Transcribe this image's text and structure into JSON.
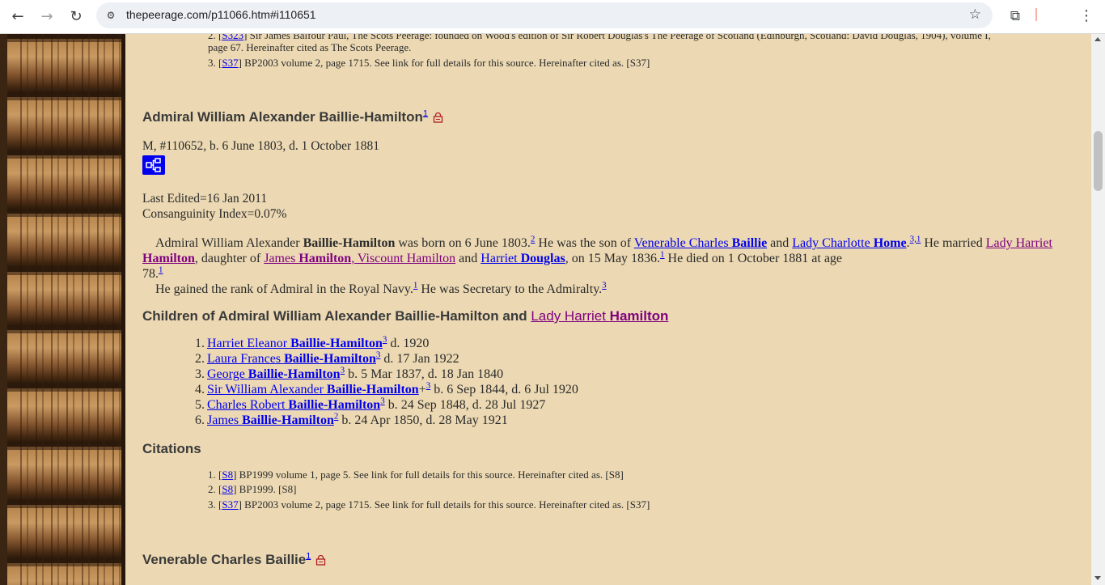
{
  "browser": {
    "url": "thepeerage.com/p11066.htm#i110651",
    "back_icon": "←",
    "forward_icon": "→",
    "reload_icon": "↻",
    "site_info_icon": "⚙",
    "star_icon": "☆",
    "extensions_icon": "⧉",
    "menu_icon": "⋮"
  },
  "top_citations": [
    {
      "num": "2.",
      "link": "S323",
      "text": " Sir James Balfour Paul, The Scots Peerage: founded on Wood's edition of Sir Robert Douglas's The Peerage of Scotland (Edinburgh, Scotland: David Douglas, 1904), volume I,"
    },
    {
      "num": "",
      "link": "",
      "text": "page 67. Hereinafter cited as The Scots Peerage."
    },
    {
      "num": "3.",
      "link": "S37",
      "text": " BP2003 volume 2, page 1715. See link for full details for this source. Hereinafter cited as. [S37]"
    }
  ],
  "person": {
    "name": "Admiral William Alexander Baillie-Hamilton",
    "name_sup": "1",
    "info": "M, #110652, b. 6 June 1803, d. 1 October 1881",
    "last_edited": "Last Edited=16 Jan 2011",
    "consanguinity": "Consanguinity Index=0.07%"
  },
  "bio": {
    "p1_a": "Admiral William Alexander ",
    "p1_b": "Baillie-Hamilton",
    "p1_c": " was born on 6 June 1803.",
    "sup1": "2",
    "p1_d": " He was the son of ",
    "father_first": "Venerable Charles ",
    "father_last": "Baillie",
    "p1_e": " and ",
    "mother_first": "Lady Charlotte ",
    "mother_last": "Home",
    "sup2": "3,1",
    "p1_f": " He married ",
    "wife_first": "Lady Harriet ",
    "wife_last": "Hamilton",
    "p1_g": ", daughter of ",
    "wf_first": "James ",
    "wf_last": "Hamilton",
    "wf_title": ", Viscount Hamilton",
    "p1_h": " and ",
    "wm_first": "Harriet ",
    "wm_last": "Douglas",
    "p1_i": ", on 15 May 1836.",
    "sup3": "1",
    "p1_j": " He died on 1 October 1881 at age",
    "p1_k": "78.",
    "sup4": "1",
    "p2_a": "He gained the rank of Admiral in the Royal Navy.",
    "sup5": "1",
    "p2_b": " He was Secretary to the Admiralty.",
    "sup6": "3"
  },
  "children_header": {
    "prefix": "Children of Admiral William Alexander Baillie-Hamilton and ",
    "spouse_first": "Lady Harriet ",
    "spouse_last": "Hamilton"
  },
  "children": [
    {
      "num": "1.",
      "first": "Harriet Eleanor ",
      "last": "Baillie-Hamilton",
      "plus": "",
      "sup": "3",
      "dates": " d. 1920"
    },
    {
      "num": "2.",
      "first": "Laura Frances ",
      "last": "Baillie-Hamilton",
      "plus": "",
      "sup": "3",
      "dates": " d. 17 Jan 1922"
    },
    {
      "num": "3.",
      "first": "George ",
      "last": "Baillie-Hamilton",
      "plus": "",
      "sup": "3",
      "dates": " b. 5 Mar 1837, d. 18 Jan 1840"
    },
    {
      "num": "4.",
      "first": "Sir William Alexander ",
      "last": "Baillie-Hamilton",
      "plus": "+",
      "sup": "3",
      "dates": " b. 6 Sep 1844, d. 6 Jul 1920"
    },
    {
      "num": "5.",
      "first": "Charles Robert ",
      "last": "Baillie-Hamilton",
      "plus": "",
      "sup": "3",
      "dates": " b. 24 Sep 1848, d. 28 Jul 1927"
    },
    {
      "num": "6.",
      "first": "James ",
      "last": "Baillie-Hamilton",
      "plus": "",
      "sup": "2",
      "dates": " b. 24 Apr 1850, d. 28 May 1921"
    }
  ],
  "citations_header": "Citations",
  "citations": [
    {
      "num": "1.",
      "link": "S8",
      "text": " BP1999 volume 1, page 5. See link for full details for this source. Hereinafter cited as. [S8]"
    },
    {
      "num": "2.",
      "link": "S8",
      "text": " BP1999. [S8]"
    },
    {
      "num": "3.",
      "link": "S37",
      "text": " BP2003 volume 2, page 1715. See link for full details for this source. Hereinafter cited as. [S37]"
    }
  ],
  "next_person": {
    "name": "Venerable Charles Baillie",
    "sup": "1"
  }
}
